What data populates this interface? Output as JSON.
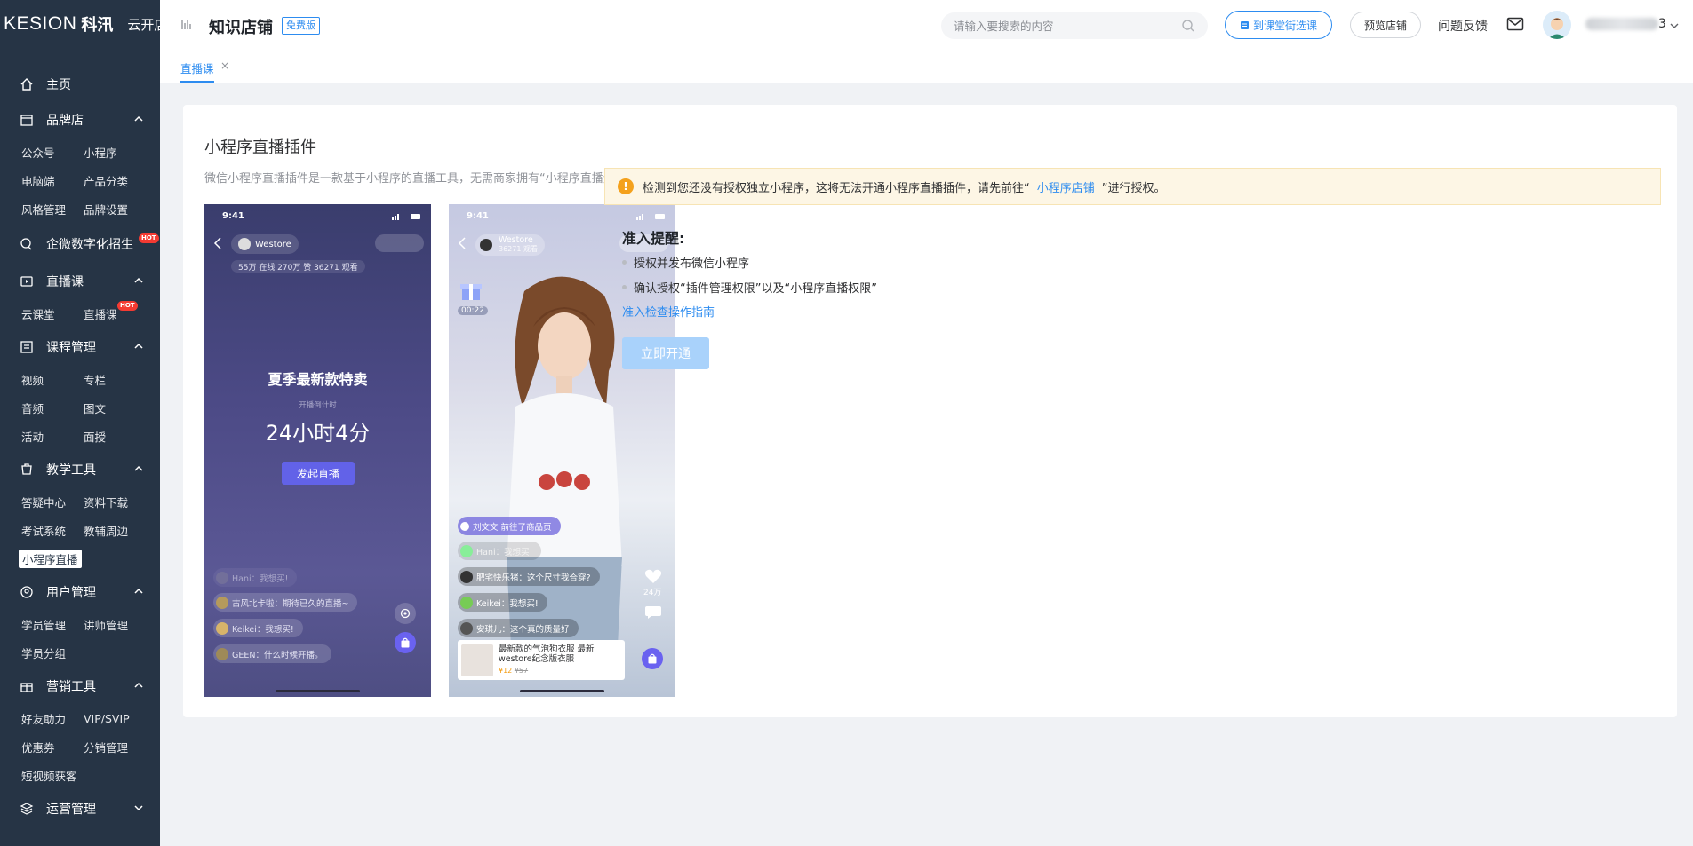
{
  "sidebar": {
    "brand_logo": "KESION",
    "brand_cn": "科汛",
    "brand_sub": "云开店",
    "home": "主页",
    "groups": [
      {
        "label": "品牌店",
        "items": [
          "公众号",
          "小程序",
          "电脑端",
          "产品分类",
          "风格管理",
          "品牌设置"
        ]
      },
      {
        "label": "企微数字化招生",
        "badge": "HOT",
        "items": []
      },
      {
        "label": "直播课",
        "items": [
          "云课堂",
          "直播课"
        ],
        "item_badge": "HOT"
      },
      {
        "label": "课程管理",
        "items": [
          "视频",
          "专栏",
          "音频",
          "图文",
          "活动",
          "面授"
        ]
      },
      {
        "label": "教学工具",
        "items": [
          "答疑中心",
          "资料下载",
          "考试系统",
          "教辅周边",
          "小程序直播"
        ]
      },
      {
        "label": "用户管理",
        "items": [
          "学员管理",
          "讲师管理",
          "学员分组"
        ]
      },
      {
        "label": "营销工具",
        "items": [
          "好友助力",
          "VIP/SVIP",
          "优惠券",
          "分销管理",
          "短视频获客"
        ]
      },
      {
        "label": "运营管理",
        "items": []
      }
    ]
  },
  "header": {
    "title": "知识店铺",
    "badge": "免费版",
    "search_placeholder": "请输入要搜索的内容",
    "btn_pick": "到课堂街选课",
    "btn_preview": "预览店铺",
    "feedback": "问题反馈",
    "user_suffix": "3"
  },
  "tabs": [
    {
      "label": "直播课",
      "close": "×"
    }
  ],
  "card": {
    "title": "小程序直播插件",
    "desc": "微信小程序直播插件是一款基于小程序的直播工具，无需商家拥有“小程序直播资质”，即可在自己的私域小程序中完成直播带货。",
    "alert_pre": "检测到您还没有授权独立小程序，这将无法开通小程序直播插件，请先前往“",
    "alert_link": "小程序店铺",
    "alert_post": "”进行授权。",
    "req_title": "准入提醒:",
    "req_items": [
      "授权并发布微信小程序",
      "确认授权“插件管理权限”以及“小程序直播权限”"
    ],
    "guide_link": "准入检查操作指南",
    "open_btn": "立即开通"
  },
  "phone1": {
    "time": "9:41",
    "room": "Westore",
    "stats": "55万 在线  270万 赞  36271 观看",
    "headline": "夏季最新款特卖",
    "countdown_label": "开播倒计时",
    "countdown": "24小时4分",
    "start_btn": "发起直播",
    "chats": [
      "Hani：我想买!",
      "古风北卡啦：期待已久的直播~",
      "Keikei：我想买!",
      "GEEN：什么时候开播。"
    ]
  },
  "phone2": {
    "time": "9:41",
    "room": "Westore",
    "room_sub": "36271 观看",
    "gift_timer": "00:22",
    "notice": "刘文文 前往了商品页",
    "chats": [
      "Hani：我想买!",
      "肥宅快乐猪：这个尺寸我合穿?",
      "Keikei：我想买!",
      "安琪儿：这个真的质量好"
    ],
    "likes": "24万",
    "product_title": "最新款的气泡狗衣服 最新westore纪念版衣服",
    "product_price": "¥12",
    "product_old": "¥57"
  },
  "colors": {
    "sidebar_bg": "#263445",
    "primary": "#2d8cf0",
    "warn": "#f4a11c"
  }
}
